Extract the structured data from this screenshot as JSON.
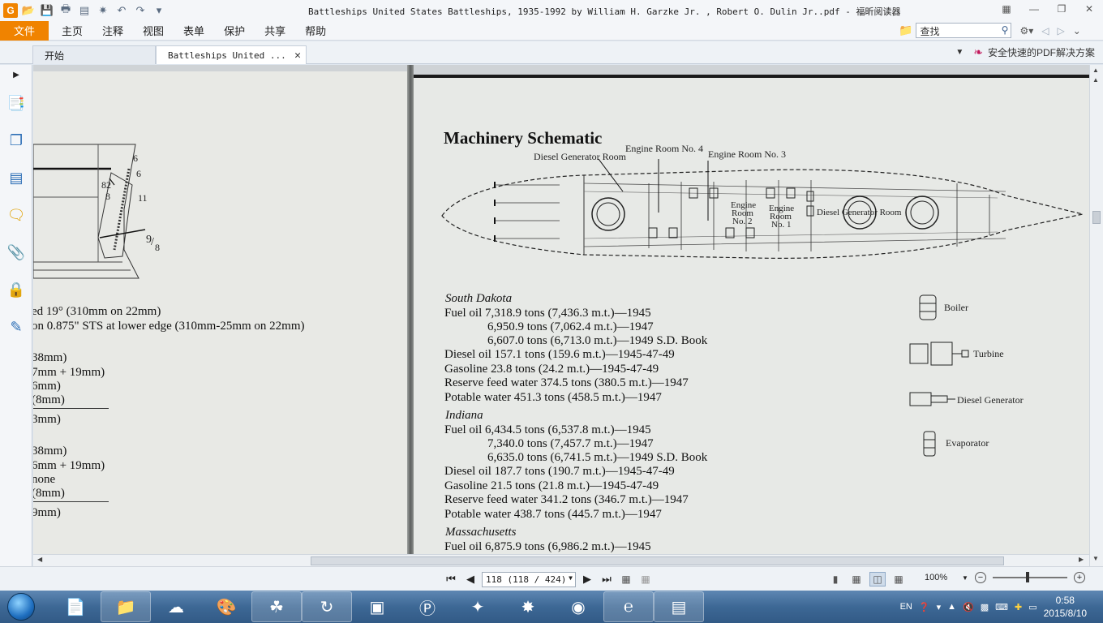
{
  "window": {
    "title": "Battleships United States Battleships, 1935-1992 by William H. Garzke Jr. , Robert O. Dulin Jr..pdf - 福昕阅读器"
  },
  "menu": {
    "file": "文件",
    "items": [
      "主页",
      "注释",
      "视图",
      "表单",
      "保护",
      "共享",
      "帮助"
    ],
    "search_value": "查找"
  },
  "tabs": {
    "start": "开始",
    "doc": "Battleships United ..."
  },
  "promo": "安全快速的PDF解决方案",
  "left_page": {
    "diagram_labels": [
      "6",
      "6",
      "82",
      "8",
      "11",
      "9",
      "8"
    ],
    "lines": [
      "ed 19° (310mm on 22mm)",
      " on 0.875\" STS at lower edge (310mm-25mm on 22mm)",
      "38mm)",
      "7mm + 19mm)",
      " 6mm)",
      "(8mm)",
      "3mm)",
      "38mm)",
      "6mm + 19mm)",
      "none",
      "(8mm)",
      "9mm)"
    ]
  },
  "right_page": {
    "heading": "Machinery Schematic",
    "schematic_labels": {
      "diesel_gen_room_top": "Diesel Generator Room",
      "engine_room_4": "Engine Room No. 4",
      "engine_room_3": "Engine Room No. 3",
      "engine_room_2": [
        "Engine",
        "Room",
        "No. 2"
      ],
      "engine_room_1": [
        "Engine",
        "Room",
        "No. 1"
      ],
      "diesel_gen_room_mid": "Diesel Generator Room"
    },
    "legend": {
      "boiler": "Boiler",
      "turbine": "Turbine",
      "diesel_generator": "Diesel Generator",
      "evaporator": "Evaporator"
    },
    "ships": [
      {
        "name": "South Dakota",
        "lines": [
          {
            "text": "Fuel oil 7,318.9 tons (7,436.3 m.t.)—1945",
            "indent": false
          },
          {
            "text": "6,950.9 tons (7,062.4 m.t.)—1947",
            "indent": true
          },
          {
            "text": "6,607.0 tons (6,713.0 m.t.)—1949 S.D. Book",
            "indent": true
          },
          {
            "text": "Diesel oil 157.1 tons (159.6 m.t.)—1945-47-49",
            "indent": false
          },
          {
            "text": "Gasoline 23.8 tons (24.2 m.t.)—1945-47-49",
            "indent": false
          },
          {
            "text": "Reserve feed water 374.5 tons (380.5 m.t.)—1947",
            "indent": false
          },
          {
            "text": "Potable water 451.3 tons (458.5 m.t.)—1947",
            "indent": false
          }
        ]
      },
      {
        "name": "Indiana",
        "lines": [
          {
            "text": "Fuel oil 6,434.5 tons (6,537.8 m.t.)—1945",
            "indent": false
          },
          {
            "text": "7,340.0 tons (7,457.7 m.t.)—1947",
            "indent": true
          },
          {
            "text": "6,635.0 tons (6,741.5 m.t.)—1949 S.D. Book",
            "indent": true
          },
          {
            "text": "Diesel oil 187.7 tons (190.7 m.t.)—1945-47-49",
            "indent": false
          },
          {
            "text": "Gasoline 21.5 tons (21.8 m.t.)—1945-47-49",
            "indent": false
          },
          {
            "text": "Reserve feed water 341.2 tons (346.7 m.t.)—1947",
            "indent": false
          },
          {
            "text": "Potable water 438.7 tons (445.7 m.t.)—1947",
            "indent": false
          }
        ]
      },
      {
        "name": "Massachusetts",
        "lines": [
          {
            "text": "Fuel oil 6,875.9 tons (6,986.2 m.t.)—1945",
            "indent": false
          }
        ]
      }
    ]
  },
  "statusbar": {
    "page_field": "118 (118 / 424)",
    "zoom_level": "100%",
    "zoom_slider_fraction": 0.45
  },
  "taskbar": {
    "ime": "EN",
    "time": "0:58",
    "date": "2015/8/10"
  },
  "colors": {
    "accent": "#f08300",
    "sidebar_icon": "#2d6fb6",
    "taskbar": "#3d6895"
  }
}
